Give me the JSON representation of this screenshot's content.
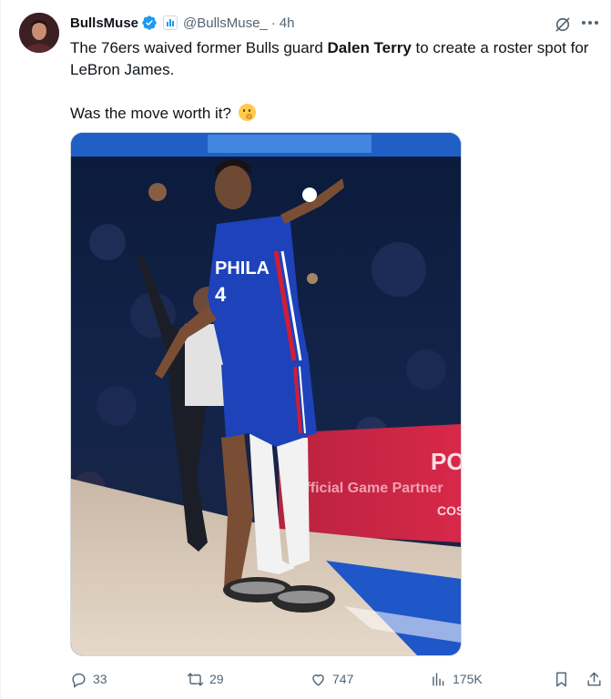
{
  "author": {
    "display_name": "BullsMuse",
    "handle": "@BullsMuse_",
    "separator": "·",
    "time": "4h"
  },
  "tweet": {
    "text_part1": "The 76ers waived former Bulls guard ",
    "text_strong": "Dalen Terry",
    "text_part2": " to create a roster spot for LeBron James.",
    "question": "Was the move worth it?"
  },
  "media": {
    "jersey_text": "PHILA",
    "jersey_number": "4",
    "ad_text": "Official Game Partner",
    "ad_short": "PO",
    "ad_short2": "COS"
  },
  "actions": {
    "replies": "33",
    "retweets": "29",
    "likes": "747",
    "views": "175K"
  },
  "colors": {
    "verified": "#1d9bf0",
    "text_secondary": "#536471",
    "sixers_blue": "#1d42ba",
    "sixers_red": "#d11d36"
  },
  "icons": [
    "verified-badge-icon",
    "affiliate-badge-icon",
    "grok-icon",
    "more-icon",
    "reply-icon",
    "retweet-icon",
    "like-icon",
    "views-icon",
    "bookmark-icon",
    "share-icon",
    "thinking-face-emoji"
  ]
}
